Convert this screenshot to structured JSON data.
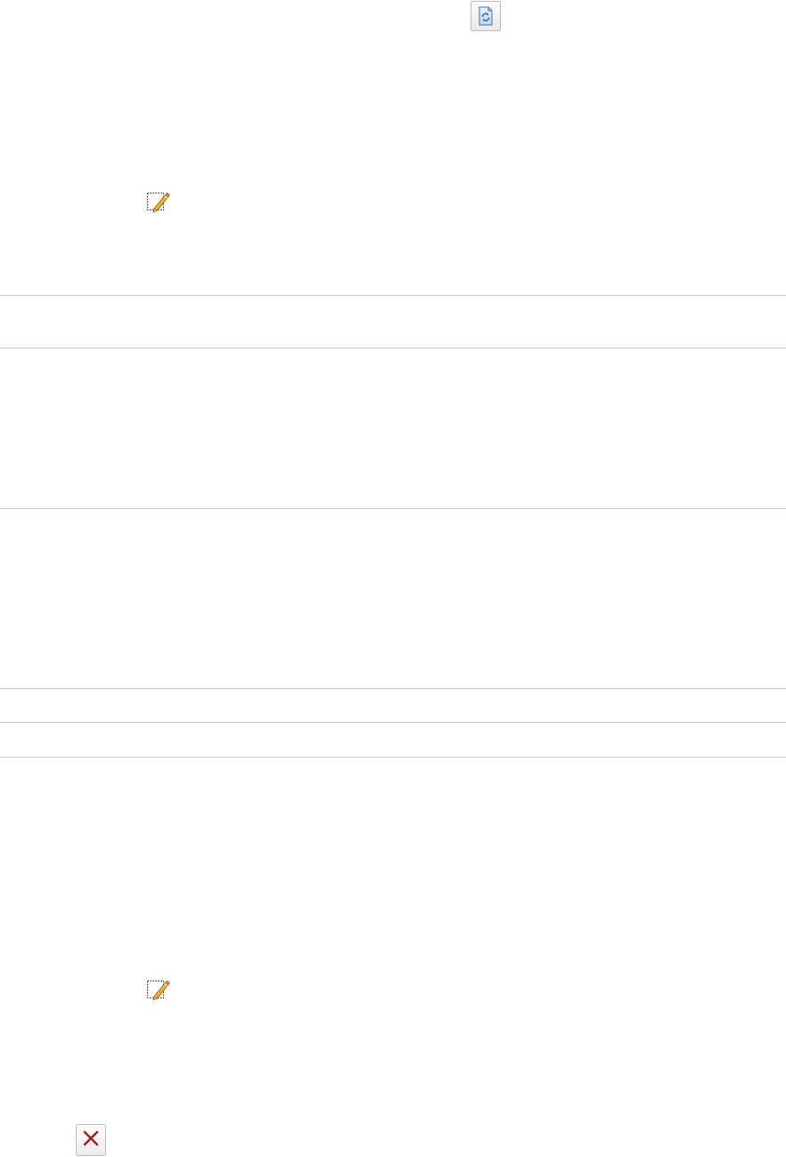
{
  "toolbar": {
    "refresh_icon": "refresh-icon"
  },
  "rows": [
    {
      "edit_icon": "edit-icon"
    },
    {
      "edit_icon": "edit-icon"
    }
  ],
  "actions": {
    "delete_icon": "delete-icon"
  },
  "colors": {
    "divider": "#c8c8c8",
    "button_border": "#b9bcc0",
    "refresh_blue": "#3b6fb0",
    "delete_red": "#9b1c1c",
    "pencil_yellow": "#f2b531"
  }
}
